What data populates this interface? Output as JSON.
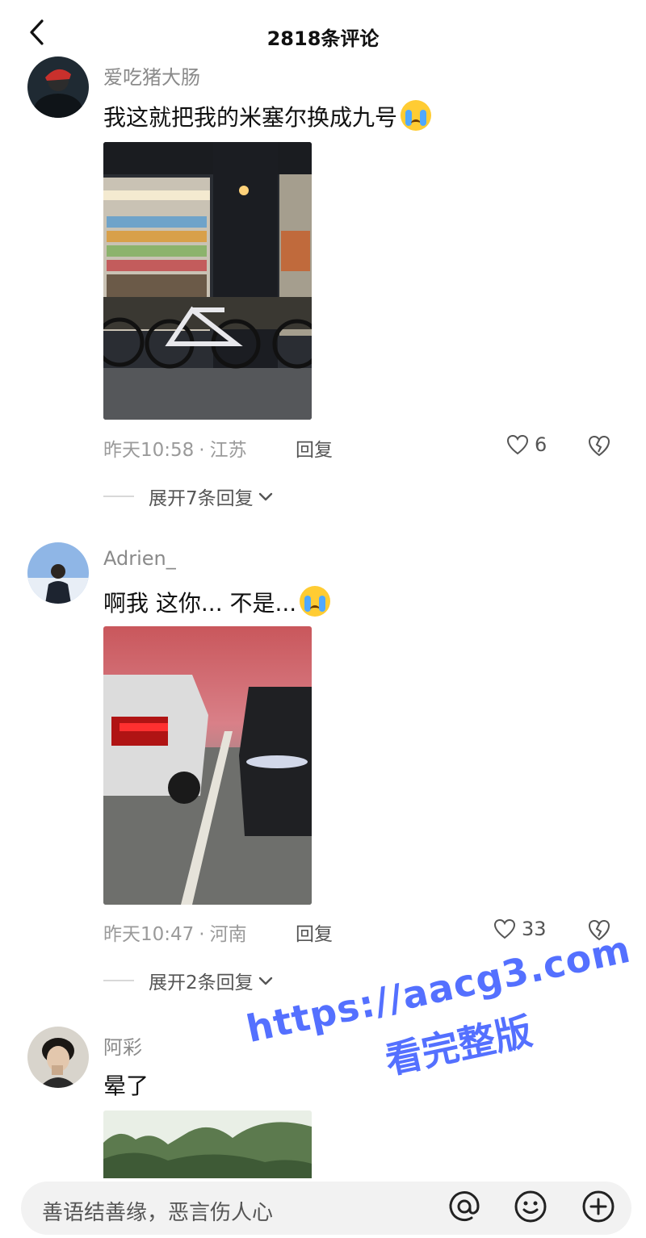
{
  "header": {
    "title": "2818条评论"
  },
  "comments": [
    {
      "username": "爱吃猪大肠",
      "text": "我这就把我的米塞尔换成九号",
      "emoji": "crying-face",
      "time": "昨天10:58",
      "location": "江苏",
      "reply_label": "回复",
      "likes": "6",
      "expand_label": "展开7条回复"
    },
    {
      "username": "Adrien_",
      "text": "啊我 这你... 不是...",
      "emoji": "crying-face",
      "time": "昨天10:47",
      "location": "河南",
      "reply_label": "回复",
      "likes": "33",
      "expand_label": "展开2条回复"
    },
    {
      "username": "阿彩",
      "text": "晕了"
    }
  ],
  "watermark": {
    "line1": "https://aacg3.com",
    "line2": "看完整版"
  },
  "input": {
    "placeholder": "善语结善缘，恶言伤人心"
  },
  "colors": {
    "watermark": "#5470ff",
    "emoji": "#ffcc33"
  }
}
